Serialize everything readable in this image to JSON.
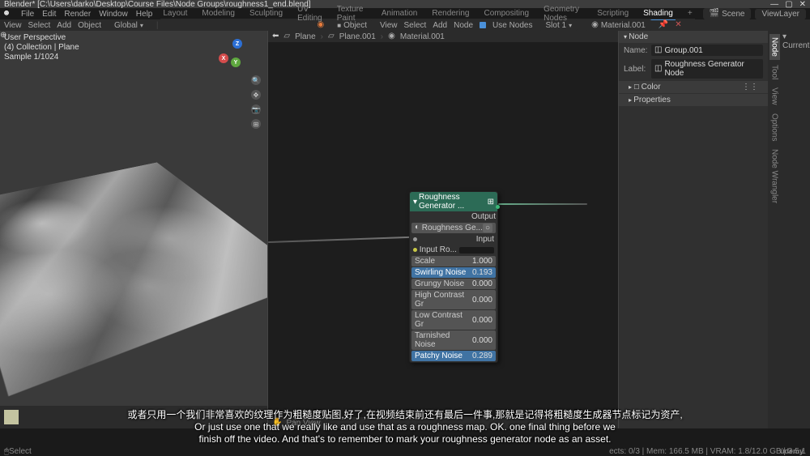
{
  "title": "Blender* [C:\\Users\\darko\\Desktop\\Course Files\\Node Groups\\roughness1_end.blend]",
  "menu": {
    "file": "File",
    "edit": "Edit",
    "render": "Render",
    "window": "Window",
    "help": "Help"
  },
  "workspaces": [
    "Layout",
    "Modeling",
    "Sculpting",
    "UV Editing",
    "Texture Paint",
    "Animation",
    "Rendering",
    "Compositing",
    "Geometry Nodes",
    "Scripting",
    "Shading",
    "+"
  ],
  "workspace_active": "Shading",
  "header_right": {
    "scene": "Scene",
    "viewlayer": "ViewLayer"
  },
  "toolstrip_left": {
    "mode1": "View",
    "mode2": "Select",
    "mode3": "Add",
    "mode4": "Object",
    "orient": "Global"
  },
  "toolstrip_mid": {
    "view": "View",
    "select": "Select",
    "add": "Add",
    "node": "Node",
    "use_nodes": "Use Nodes",
    "slot": "Slot 1",
    "material": "Material.001",
    "object_mode": "Object"
  },
  "viewport": {
    "line1": "User Perspective",
    "line2": "(4) Collection | Plane",
    "line3": "Sample 1/1024",
    "panview": "Pan View"
  },
  "breadcrumb": [
    "Plane",
    "Plane.001",
    "Material.001"
  ],
  "node": {
    "title": "Roughness Generator ...",
    "output": "Output",
    "preview": "Roughness Ge...",
    "input": "Input",
    "input_ro": "Input Ro...",
    "rows": [
      {
        "name": "Scale",
        "val": "1.000",
        "blue": false
      },
      {
        "name": "Swirling Noise",
        "val": "0.193",
        "blue": true
      },
      {
        "name": "Grungy Noise",
        "val": "0.000",
        "blue": false
      },
      {
        "name": "High Contrast Gr",
        "val": "0.000",
        "blue": false
      },
      {
        "name": "Low Contrast Gr",
        "val": "0.000",
        "blue": false
      },
      {
        "name": "Tarnished Noise",
        "val": "0.000",
        "blue": false
      },
      {
        "name": "Patchy Noise",
        "val": "0.289",
        "blue": true
      }
    ]
  },
  "sidepanel": {
    "header": "Node",
    "name_label": "Name:",
    "name_value": "Group.001",
    "label_label": "Label:",
    "label_value": "Roughness Generator Node",
    "color": "Color",
    "properties": "Properties"
  },
  "vtabs": [
    "Node",
    "Tool",
    "View",
    "Options",
    "Node Wrangler"
  ],
  "outliner": {
    "current": "Current"
  },
  "status": {
    "select": "Select",
    "right": "ects: 0/3 | Mem: 166.5 MB | VRAM: 1.8/12.0 GB | 3.5.1"
  },
  "subtitle": {
    "cn": "或者只用一个我们非常喜欢的纹理作为粗糙度贴图,好了,在视频结束前还有最后一件事,那就是记得将粗糙度生成器节点标记为资产,",
    "en1": "Or just use one that we really like and use that as a roughness map. OK. one final thing before we",
    "en2": "finish off the video. And that's to remember to mark your roughness generator node as an asset."
  },
  "udemy": "ûdemy"
}
